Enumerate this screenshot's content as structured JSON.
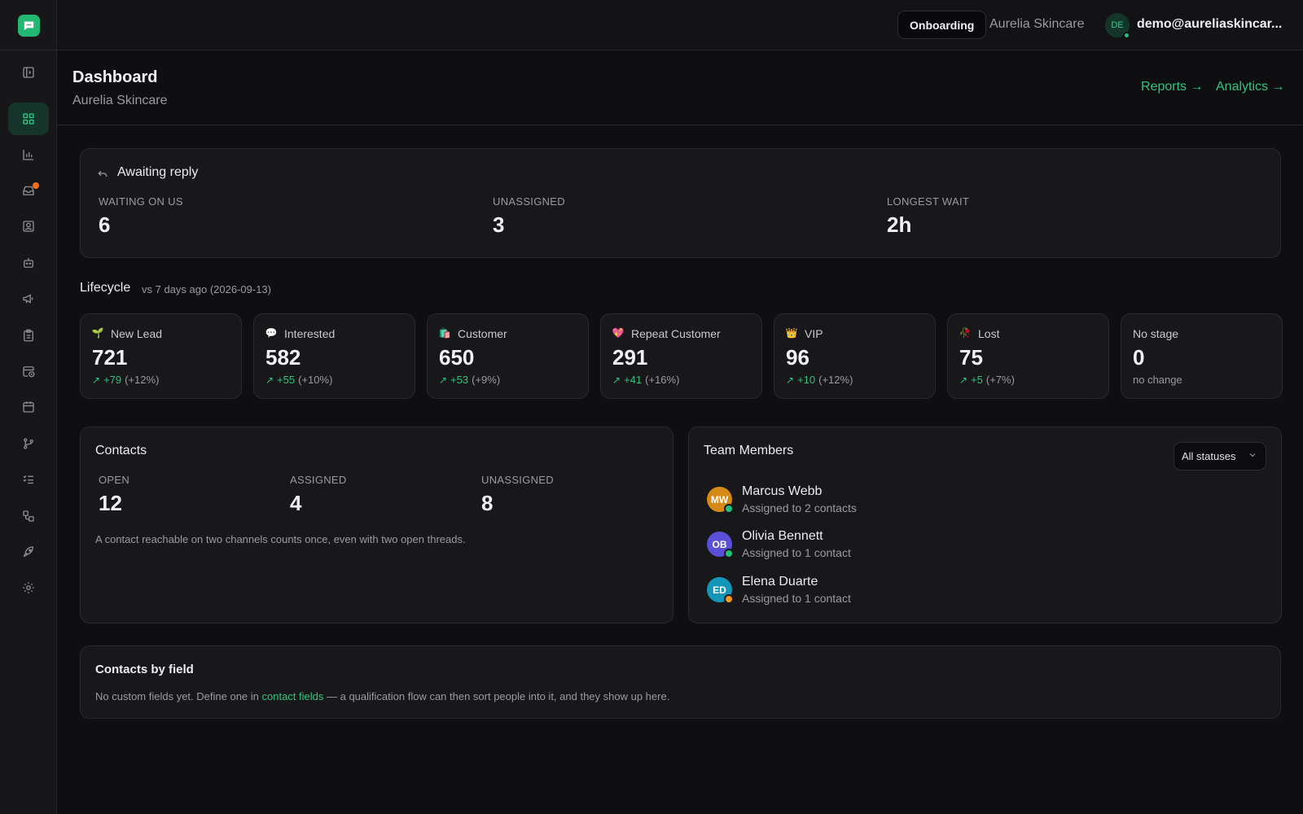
{
  "app": {
    "org_name": "Aurelia Skincare",
    "onboarding_label": "Onboarding",
    "user_initials": "DE",
    "user_email": "demo@aureliaskincar..."
  },
  "page": {
    "title": "Dashboard",
    "subtitle": "Aurelia Skincare",
    "links": [
      "Reports →",
      "Analytics →"
    ]
  },
  "awaiting": {
    "title": "Awaiting reply",
    "stats": [
      {
        "label": "WAITING ON US",
        "value": "6"
      },
      {
        "label": "UNASSIGNED",
        "value": "3"
      },
      {
        "label": "LONGEST WAIT",
        "value": "2h"
      }
    ]
  },
  "lifecycle": {
    "title": "Lifecycle",
    "comparison": "vs 7 days ago (2026-09-13)",
    "stages": [
      {
        "emoji": "🌱",
        "name": "New Lead",
        "value": "721",
        "delta": "+79",
        "pct": "(+12%)"
      },
      {
        "emoji": "💬",
        "name": "Interested",
        "value": "582",
        "delta": "+55",
        "pct": "(+10%)"
      },
      {
        "emoji": "🛍️",
        "name": "Customer",
        "value": "650",
        "delta": "+53",
        "pct": "(+9%)"
      },
      {
        "emoji": "💖",
        "name": "Repeat Customer",
        "value": "291",
        "delta": "+41",
        "pct": "(+16%)"
      },
      {
        "emoji": "👑",
        "name": "VIP",
        "value": "96",
        "delta": "+10",
        "pct": "(+12%)"
      },
      {
        "emoji": "🥀",
        "name": "Lost",
        "value": "75",
        "delta": "+5",
        "pct": "(+7%)"
      },
      {
        "emoji": "",
        "name": "No stage",
        "value": "0",
        "delta": "",
        "pct": "no change"
      }
    ]
  },
  "contacts": {
    "title": "Contacts",
    "stats": [
      {
        "label": "OPEN",
        "value": "12"
      },
      {
        "label": "ASSIGNED",
        "value": "4"
      },
      {
        "label": "UNASSIGNED",
        "value": "8"
      }
    ],
    "note": "A contact reachable on two channels counts once, even with two open threads."
  },
  "team": {
    "title": "Team Members",
    "filter": "All statuses",
    "members": [
      {
        "initials": "MW",
        "name": "Marcus Webb",
        "sub": "Assigned to 2 contacts",
        "color": "#d48a14",
        "status": "#22c07a"
      },
      {
        "initials": "OB",
        "name": "Olivia Bennett",
        "sub": "Assigned to 1 contact",
        "color": "#5b4fd8",
        "status": "#22c07a"
      },
      {
        "initials": "ED",
        "name": "Elena Duarte",
        "sub": "Assigned to 1 contact",
        "color": "#1496b8",
        "status": "#f29a1f"
      }
    ]
  },
  "fields": {
    "title": "Contacts by field",
    "text_before": "No custom fields yet. Define one in ",
    "link": "contact fields",
    "text_after": " — a qualification flow can then sort people into it, and they show up here."
  },
  "sidebar": {
    "icons": [
      "sidebar-toggle-icon",
      "dashboard-icon",
      "bar-chart-icon",
      "inbox-icon",
      "contacts-icon",
      "bot-icon",
      "megaphone-icon",
      "clipboard-icon",
      "calendar-clock-icon",
      "calendar-icon",
      "branch-icon",
      "checklist-icon",
      "workflow-icon",
      "rocket-icon",
      "gear-icon"
    ]
  },
  "colors": {
    "accent": "#2fc47f",
    "logo": "#22b873",
    "alert_dot": "#f0701d"
  }
}
